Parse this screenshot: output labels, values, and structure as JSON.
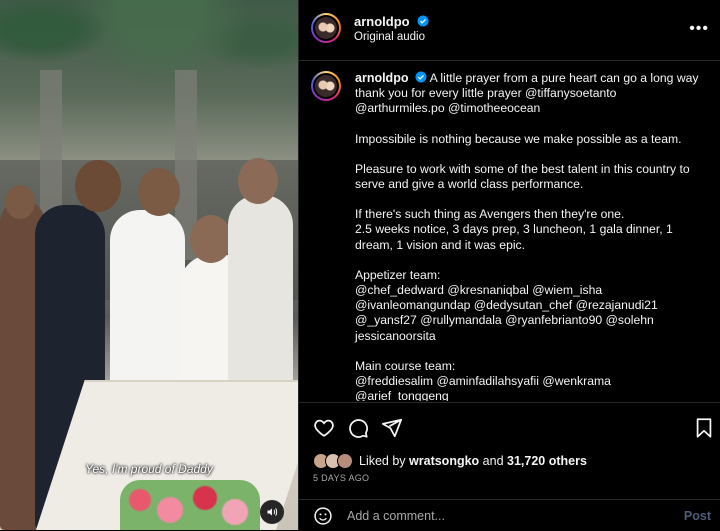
{
  "media": {
    "caption": "Yes, I'm proud of Daddy",
    "mute_icon": "speaker-icon"
  },
  "header": {
    "username": "arnoldpo",
    "subtitle": "Original audio",
    "more_icon": "more-options-icon"
  },
  "post": {
    "author": "arnoldpo",
    "paragraphs": [
      [
        "A little prayer from a pure heart can go a long way",
        "thank you for every little prayer @tiffanysoetanto",
        "@arthurmiles.po @timotheeocean"
      ],
      [
        "Impossibile is nothing because we make possible as a team."
      ],
      [
        "Pleasure to work with some of the best talent in this country to",
        "serve and give a world class performance."
      ],
      [
        "If there's such thing as Avengers then they're one.",
        "2.5 weeks notice, 3 days prep, 3 luncheon, 1 gala dinner, 1",
        "dream, 1 vision and it was epic."
      ],
      [
        "Appetizer team:",
        "@chef_dedward @kresnaniqbal @wiem_isha",
        "@ivanleomangundap @dedysutan_chef @rezajanudi21",
        "@_yansf27 @rullymandala @ryanfebrianto90 @solehn",
        "jessicanoorsita"
      ],
      [
        "Main course team:",
        "@freddiesalim @aminfadilahsyafii @wenkrama @arief_tonggeng"
      ]
    ]
  },
  "actions": {
    "like_icon": "heart-icon",
    "comment_icon": "comment-icon",
    "share_icon": "share-icon",
    "save_icon": "bookmark-icon"
  },
  "likes": {
    "liked_by_prefix": "Liked by ",
    "liked_by_user": "wratsongko",
    "and": " and ",
    "others": "31,720 others"
  },
  "timestamp": "5 DAYS AGO",
  "comment": {
    "emoji_icon": "emoji-icon",
    "placeholder": "Add a comment...",
    "post_label": "Post"
  },
  "colors": {
    "verified": "#0095f6",
    "background": "#000000",
    "divider": "#262626",
    "post_button": "#4b5c7a"
  }
}
